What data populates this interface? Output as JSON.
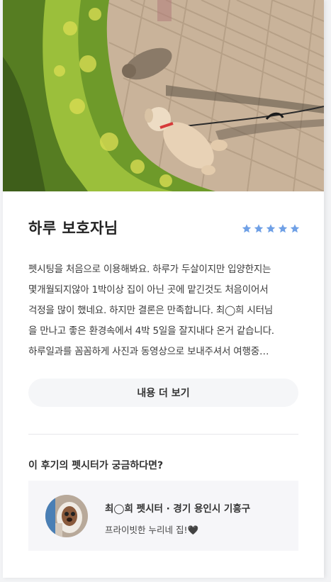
{
  "review": {
    "title": "하루 보호자님",
    "rating": 5,
    "star_color": "#6fa0e6",
    "lines": [
      "펫시팅을 처음으로 이용해봐요. 하루가 두살이지만 입양한지는",
      "몇개월되지않아 1박이상 집이 아닌 곳에 맡긴것도 처음이어서",
      "걱정을 많이 했네요. 하지만 결론은 만족합니다. 최◯희 시터님",
      "을 만나고 좋은 환경속에서 4박 5일을 잘지내다 온거 같습니다.",
      "하루일과를 꼼꼼하게 사진과 동영상으로 보내주셔서 여행중…"
    ],
    "more_label": "내용 더 보기"
  },
  "sitter_section": {
    "title": "이 후기의 펫시터가 궁금하다면?",
    "sitter": {
      "name": "최◯희 펫시터 · 경기 용인시 기흥구",
      "description": "프라이빗한 누리네 집!🖤"
    }
  }
}
